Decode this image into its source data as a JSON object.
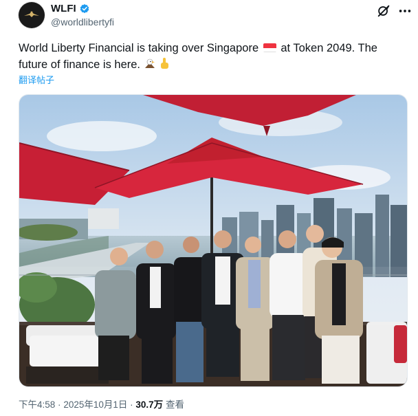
{
  "author": {
    "display_name": "WLFI",
    "handle": "@worldlibertyfi",
    "verified": true,
    "avatar_icon": "eagle-logo-icon"
  },
  "tweet": {
    "text_part1": "World Liberty Financial is taking over Singapore",
    "text_part2": "at Token 2049. The future of finance is here.",
    "translate_label": "翻译帖子",
    "emojis": [
      "singapore-flag-icon",
      "eagle-emoji-icon",
      "pointing-up-emoji-icon"
    ]
  },
  "meta": {
    "time": "下午4:58",
    "date": "2025年10月1日",
    "views": "30.7万",
    "views_label": "查看",
    "sep": "·"
  },
  "colors": {
    "accent": "#1d9bf0",
    "umbrella_red": "#d7263d",
    "text_secondary": "#536471"
  }
}
